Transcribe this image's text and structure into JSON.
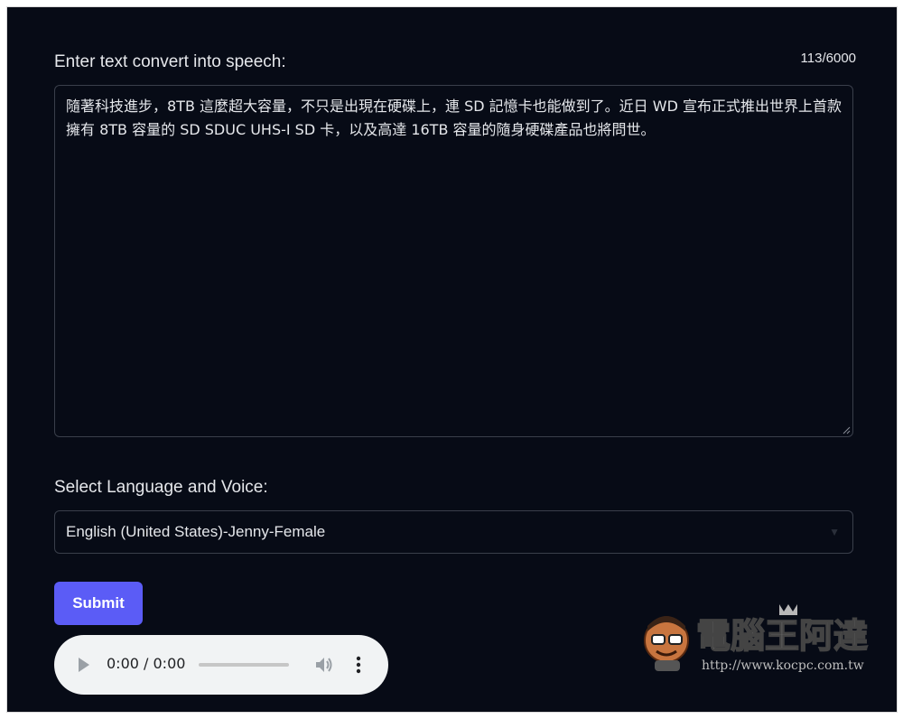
{
  "form": {
    "text_label": "Enter text convert into speech:",
    "char_count": "113/6000",
    "text_value": "隨著科技進步，8TB 這麼超大容量，不只是出現在硬碟上，連 SD 記憶卡也能做到了。近日 WD 宣布正式推出世界上首款擁有 8TB 容量的 SD SDUC UHS-I SD 卡，以及高達 16TB 容量的隨身硬碟產品也將問世。",
    "voice_label": "Select Language and Voice:",
    "voice_selected": "English (United States)-Jenny-Female",
    "submit_label": "Submit"
  },
  "player": {
    "time": "0:00 / 0:00",
    "progress": 0
  },
  "watermark": {
    "brand": "電腦王阿達",
    "url": "http://www.kocpc.com.tw"
  },
  "colors": {
    "background": "#070b16",
    "accent": "#5b5cf6",
    "text": "#e5e7eb",
    "player": "#f1f3f4"
  }
}
